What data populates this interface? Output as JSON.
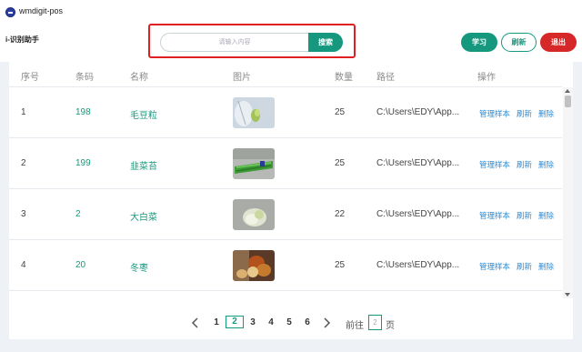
{
  "window": {
    "title": "wmdigit-pos"
  },
  "header": {
    "brand": "i-识别助手",
    "search_placeholder": "请输入内容",
    "search_button": "搜索",
    "learn_button": "学习",
    "refresh_button": "刷新",
    "exit_button": "退出"
  },
  "table": {
    "columns": [
      "序号",
      "条码",
      "名称",
      "图片",
      "数量",
      "路径",
      "操作"
    ],
    "rows": [
      {
        "index": "1",
        "barcode": "198",
        "name": "毛豆粒",
        "quantity": "25",
        "path": "C:\\Users\\EDY\\App...",
        "thumb": "thumb-1"
      },
      {
        "index": "2",
        "barcode": "199",
        "name": "韭菜苔",
        "quantity": "25",
        "path": "C:\\Users\\EDY\\App...",
        "thumb": "thumb-2"
      },
      {
        "index": "3",
        "barcode": "2",
        "name": "大白菜",
        "quantity": "22",
        "path": "C:\\Users\\EDY\\App...",
        "thumb": "thumb-3"
      },
      {
        "index": "4",
        "barcode": "20",
        "name": "冬枣",
        "quantity": "25",
        "path": "C:\\Users\\EDY\\App...",
        "thumb": "thumb-4"
      }
    ],
    "actions": {
      "manage": "管理样本",
      "refresh": "刷新",
      "delete": "删除"
    }
  },
  "pagination": {
    "pages": [
      "1",
      "2",
      "3",
      "4",
      "5",
      "6"
    ],
    "current": "2",
    "goto_label": "前往",
    "goto_value": "2",
    "goto_unit": "页"
  },
  "colors": {
    "accent": "#16987e",
    "danger": "#d62828",
    "link": "#2b8cd6",
    "highlight": "#e02020"
  }
}
